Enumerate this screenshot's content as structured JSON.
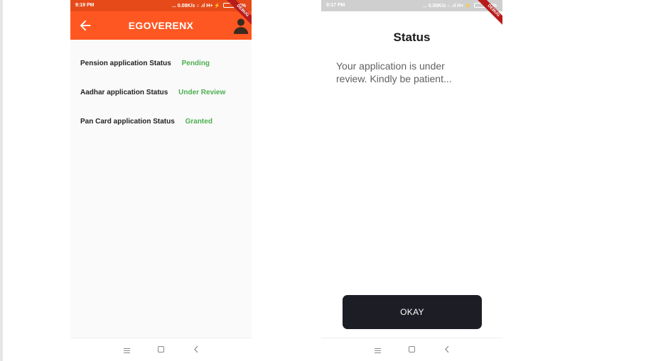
{
  "left_screen": {
    "status_bar": {
      "time": "9:19 PM",
      "indicators": "... 0.08K/s",
      "network": "H+",
      "battery": "14%"
    },
    "debug_banner": "DEBUG",
    "app_bar": {
      "title": "EGOVERENX",
      "back_icon": "arrow-back-icon",
      "profile_icon": "person-icon"
    },
    "statuses": [
      {
        "label": "Pension application Status",
        "value": "Pending"
      },
      {
        "label": "Aadhar application Status",
        "value": "Under Review"
      },
      {
        "label": "Pan Card application Status",
        "value": "Granted"
      }
    ],
    "nav_bar": {
      "menu_icon": "menu-icon",
      "home_icon": "home-square-icon",
      "back_icon": "back-chevron-icon"
    }
  },
  "right_screen": {
    "status_bar": {
      "time": "9:17 PM",
      "indicators": "... 0.00K/s",
      "network": "H+",
      "battery": "14%"
    },
    "debug_banner": "DEBUG",
    "dialog": {
      "title": "Status",
      "message": "Your application is under review. Kindly be patient...",
      "button_label": "OKAY"
    },
    "nav_bar": {
      "menu_icon": "menu-icon",
      "home_icon": "home-square-icon",
      "back_icon": "back-chevron-icon"
    }
  },
  "colors": {
    "app_bar": "#ff5722",
    "status_bar_left": "#e64a19",
    "status_value": "#4caf50",
    "okay_button": "#1d1d26",
    "debug_ribbon": "#b71c1c"
  }
}
